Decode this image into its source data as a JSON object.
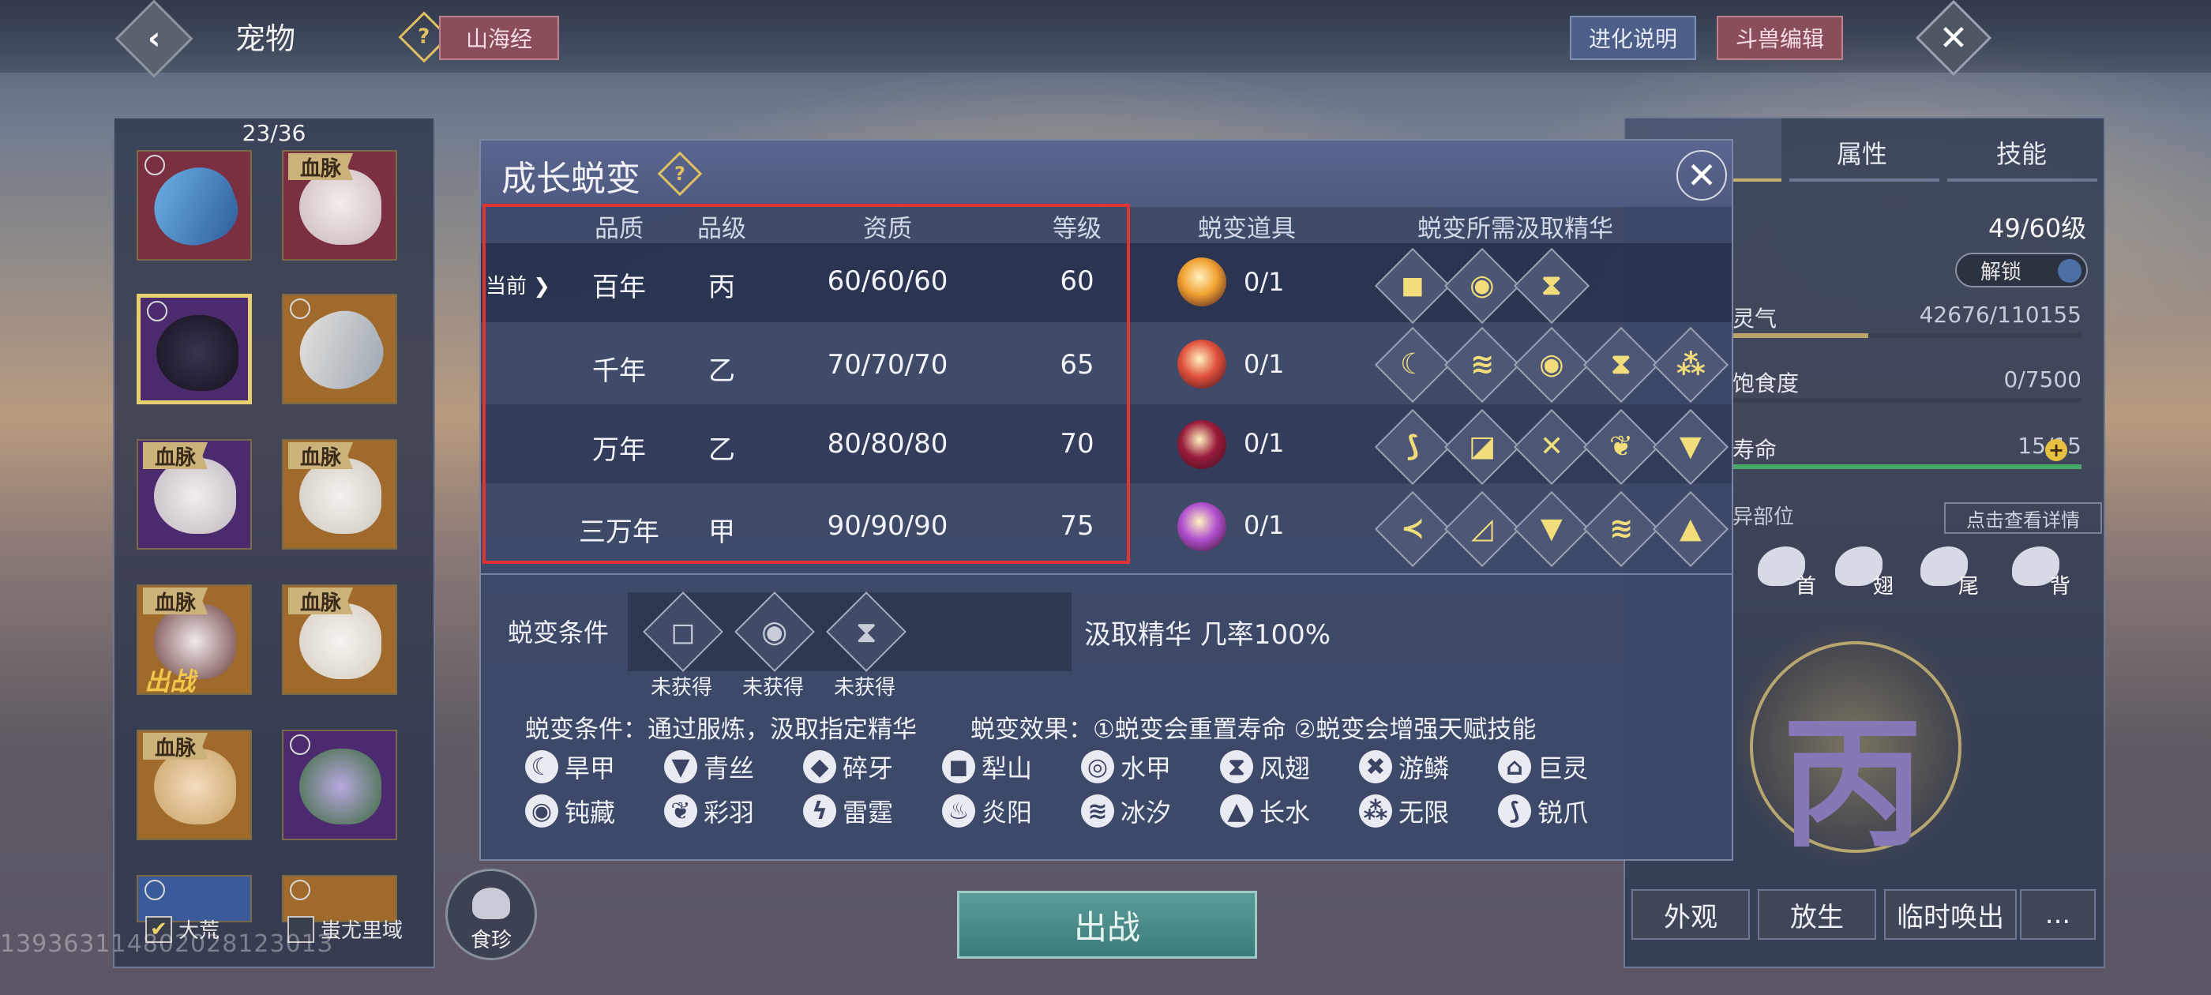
{
  "topbar": {
    "title": "宠物",
    "shanhai_label": "山海经",
    "evo_help_label": "进化说明",
    "fight_edit_label": "斗兽编辑"
  },
  "pet_list": {
    "count": "23/36",
    "blood_tag": "血脉",
    "fighting_tag": "出战",
    "filters": [
      {
        "label": "大荒",
        "checked": true
      },
      {
        "label": "蚩尤里域",
        "checked": false
      }
    ]
  },
  "watermark": "13936311480202812301З",
  "food_button": "食珍",
  "fight_button": "出战",
  "right_panel": {
    "tabs": [
      "属性",
      "技能"
    ],
    "level": "49/60级",
    "unlock_label": "解锁",
    "stats": [
      {
        "label": "灵气",
        "value": "42676/110155",
        "progress": 0.39,
        "color": "#b8a36a"
      },
      {
        "label": "饱食度",
        "value": "0/7500",
        "progress": 0,
        "color": "#b8a36a"
      },
      {
        "label": "寿命",
        "value": "15/15",
        "progress": 1.0,
        "color": "#4aa86a"
      }
    ],
    "parts_label": "异部位",
    "detail_button": "点击查看详情",
    "parts": [
      "首",
      "翅",
      "尾",
      "背"
    ],
    "grade": "丙",
    "bottom_buttons": [
      "外观",
      "放生",
      "临时唤出",
      "..."
    ]
  },
  "modal": {
    "title": "成长蜕变",
    "headers": {
      "quality": "品质",
      "grade": "品级",
      "aptitude": "资质",
      "level": "等级",
      "item": "蜕变道具",
      "essence": "蜕变所需汲取精华"
    },
    "current_marker": "当前",
    "rows": [
      {
        "quality": "百年",
        "grade": "丙",
        "aptitude": "60/60/60",
        "level": "60",
        "item_count": "0/1",
        "orb_color": "#f0a030",
        "essences": [
          "◼",
          "◉",
          "⧗"
        ]
      },
      {
        "quality": "千年",
        "grade": "乙",
        "aptitude": "70/70/70",
        "level": "65",
        "item_count": "0/1",
        "orb_color": "#e0503a",
        "essences": [
          "☾",
          "≋",
          "◉",
          "⧗",
          "⁂"
        ]
      },
      {
        "quality": "万年",
        "grade": "乙",
        "aptitude": "80/80/80",
        "level": "70",
        "item_count": "0/1",
        "orb_color": "#9a1a3a",
        "essences": [
          "⟆",
          "◪",
          "✕",
          "❦",
          "▼"
        ]
      },
      {
        "quality": "三万年",
        "grade": "甲",
        "aptitude": "90/90/90",
        "level": "75",
        "item_count": "0/1",
        "orb_color": "#b050d0",
        "essences": [
          "≺",
          "◿",
          "▼",
          "≋",
          "▲"
        ]
      }
    ],
    "condition_label": "蜕变条件",
    "condition_slots": [
      {
        "glyph": "◻",
        "status": "未获得"
      },
      {
        "glyph": "◉",
        "status": "未获得"
      },
      {
        "glyph": "⧗",
        "status": "未获得"
      }
    ],
    "absorb_rate": "汲取精华 几率100%",
    "rule_condition": "蜕变条件：通过服炼，汲取指定精华",
    "rule_effect": "蜕变效果：①蜕变会重置寿命 ②蜕变会增强天赋技能",
    "legend": [
      {
        "glyph": "☾",
        "label": "旱甲"
      },
      {
        "glyph": "▼",
        "label": "青丝"
      },
      {
        "glyph": "◆",
        "label": "碎牙"
      },
      {
        "glyph": "◼",
        "label": "犁山"
      },
      {
        "glyph": "◎",
        "label": "水甲"
      },
      {
        "glyph": "⧗",
        "label": "风翅"
      },
      {
        "glyph": "✖",
        "label": "游鳞"
      },
      {
        "glyph": "⌂",
        "label": "巨灵"
      },
      {
        "glyph": "◉",
        "label": "钝藏"
      },
      {
        "glyph": "❦",
        "label": "彩羽"
      },
      {
        "glyph": "ϟ",
        "label": "雷霆"
      },
      {
        "glyph": "♨",
        "label": "炎阳"
      },
      {
        "glyph": "≋",
        "label": "冰汐"
      },
      {
        "glyph": "▲",
        "label": "长水"
      },
      {
        "glyph": "⁂",
        "label": "无限"
      },
      {
        "glyph": "⟆",
        "label": "锐爪"
      }
    ]
  }
}
